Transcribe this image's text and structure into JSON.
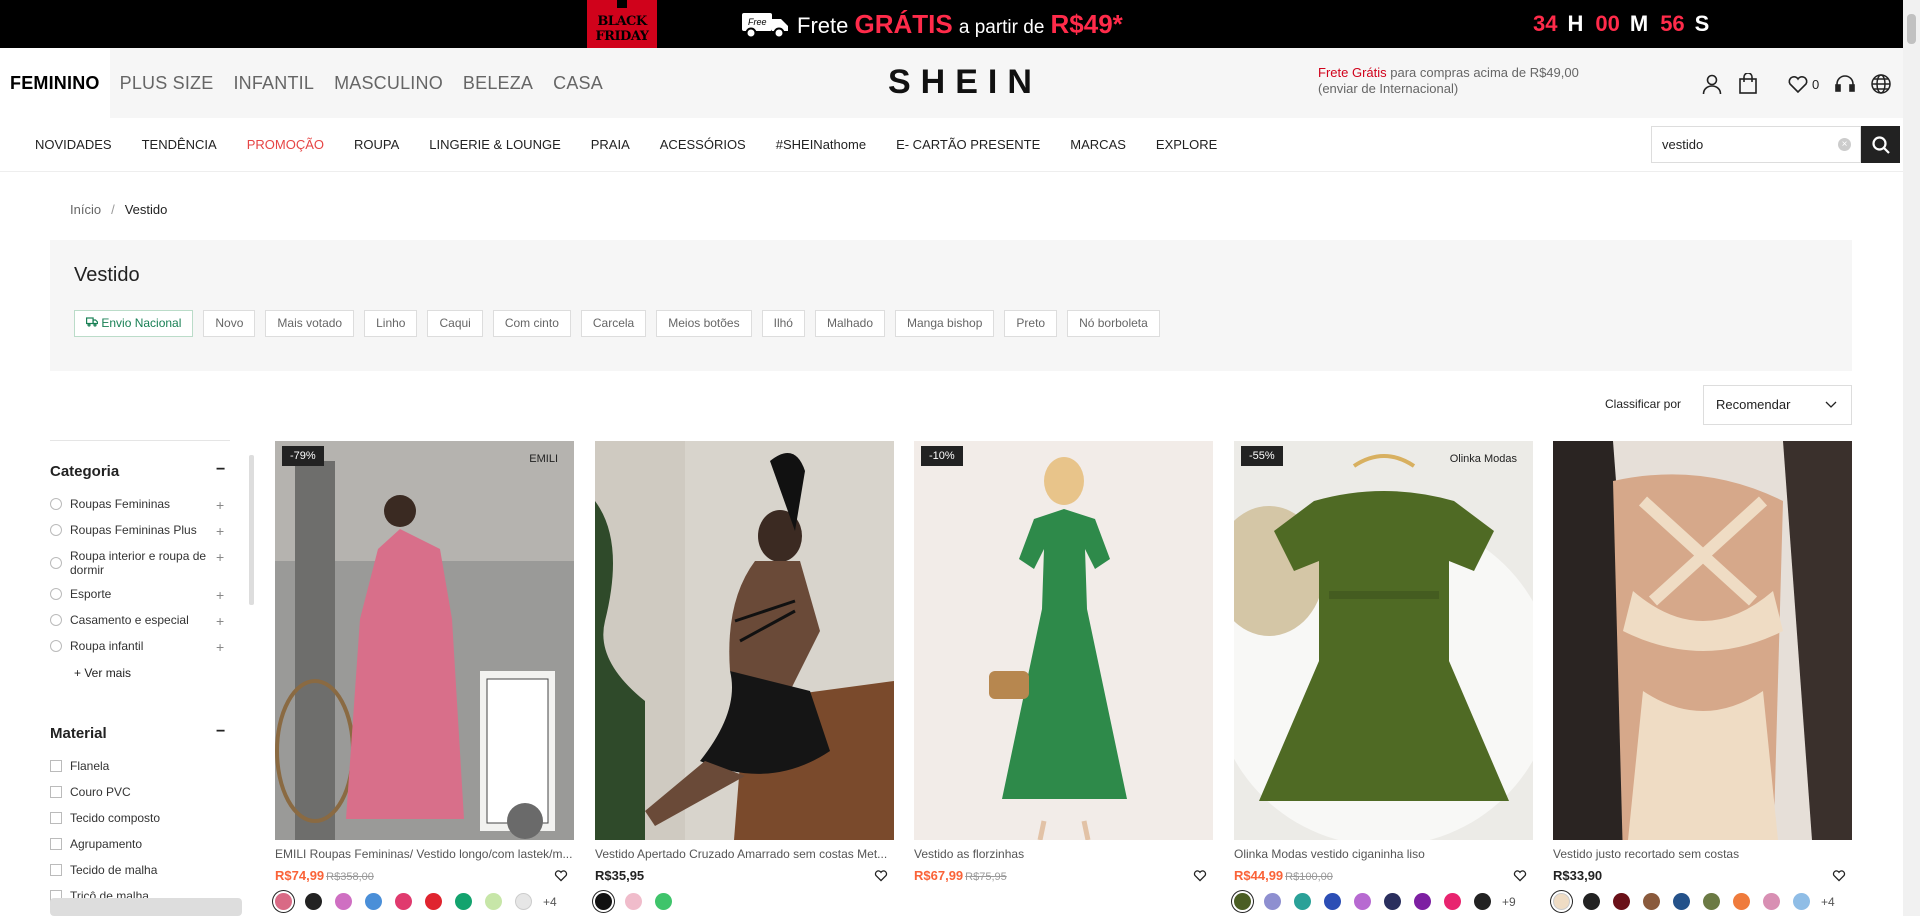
{
  "promo": {
    "black_friday": "BLACK FRIDAY",
    "free_badge": "Free",
    "text_pre": "Frete",
    "text_hl": "GRÁTIS",
    "text_mid": "a partir de",
    "text_price": "R$49*",
    "countdown": {
      "hours": "34",
      "h": "H",
      "minutes": "00",
      "m": "M",
      "seconds": "56",
      "s": "S"
    }
  },
  "header": {
    "tabs": [
      "FEMININO",
      "PLUS SIZE",
      "INFANTIL",
      "MASCULINO",
      "BELEZA",
      "CASA"
    ],
    "logo": "SHEIN",
    "free_ship_red": "Frete Grátis",
    "free_ship_rest": " para compras acima de R$49,00",
    "free_ship_sub": "(enviar de Internacional)",
    "wishlist_count": "0"
  },
  "catnav": [
    "NOVIDADES",
    "TENDÊNCIA",
    "PROMOÇÃO",
    "ROUPA",
    "LINGERIE & LOUNGE",
    "PRAIA",
    "ACESSÓRIOS",
    "#SHEINathome",
    "E- CARTÃO PRESENTE",
    "MARCAS",
    "EXPLORE"
  ],
  "search": {
    "value": "vestido"
  },
  "breadcrumb": {
    "home": "Início",
    "sep": "/",
    "current": "Vestido"
  },
  "page_title": "Vestido",
  "chips": [
    "Envio Nacional",
    "Novo",
    "Mais votado",
    "Linho",
    "Caqui",
    "Com cinto",
    "Carcela",
    "Meios botões",
    "Ilhó",
    "Malhado",
    "Manga bishop",
    "Preto",
    "Nó borboleta"
  ],
  "sort": {
    "label": "Classificar por",
    "value": "Recomendar"
  },
  "sidebar": {
    "category_title": "Categoria",
    "categories": [
      "Roupas Femininas",
      "Roupas Femininas Plus",
      "Roupa interior e roupa de dormir",
      "Esporte",
      "Casamento e especial",
      "Roupa infantil"
    ],
    "see_more": "+ Ver mais",
    "material_title": "Material",
    "materials": [
      "Flanela",
      "Couro PVC",
      "Tecido composto",
      "Agrupamento",
      "Tecido de malha",
      "Tricô de malha"
    ]
  },
  "products": [
    {
      "name": "EMILI Roupas Femininas/ Vestido longo/com lastek/m...",
      "price": "R$74,99",
      "orig": "R$358,00",
      "badge": "-79%",
      "brand": "EMILI",
      "sale": true,
      "swatches": [
        "#d96a85",
        "#222222",
        "#cf6fc2",
        "#4a8fd8",
        "#e03a6e",
        "#e0242f",
        "#13a36e",
        "#c7e6a8",
        "#e6e6e6"
      ],
      "more": "+4"
    },
    {
      "name": "Vestido Apertado Cruzado Amarrado sem costas Met...",
      "price": "R$35,95",
      "orig": "",
      "badge": "",
      "brand": "",
      "sale": false,
      "swatches": [
        "#111111",
        "#f0bccb",
        "#3fc46b"
      ],
      "more": ""
    },
    {
      "name": "Vestido as florzinhas",
      "price": "R$67,99",
      "orig": "R$75,95",
      "badge": "-10%",
      "brand": "",
      "sale": true,
      "swatches": [],
      "more": ""
    },
    {
      "name": "Olinka Modas vestido ciganinha liso",
      "price": "R$44,99",
      "orig": "R$100,00",
      "badge": "-55%",
      "brand": "Olinka Modas",
      "sale": true,
      "swatches": [
        "#4b5e24",
        "#8e8fd0",
        "#2aa198",
        "#2c4eb5",
        "#b76ad1",
        "#2a2f5e",
        "#7d1fa2",
        "#e8246f",
        "#222222"
      ],
      "more": "+9"
    },
    {
      "name": "Vestido justo recortado sem costas",
      "price": "R$33,90",
      "orig": "",
      "badge": "",
      "brand": "",
      "sale": false,
      "swatches": [
        "#efdcc4",
        "#222222",
        "#6a1018",
        "#8a5a3c",
        "#24528a",
        "#6b7a44",
        "#ef7b3c",
        "#d88fb3",
        "#8fbde6"
      ],
      "more": "+4"
    }
  ]
}
